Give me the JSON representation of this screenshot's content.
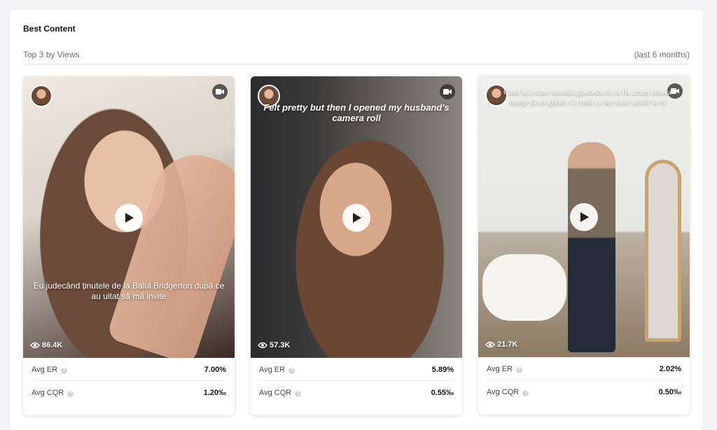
{
  "section": {
    "title": "Best Content",
    "subtitle": "Top 3 by Views",
    "period": "(last 6 months)"
  },
  "cards": [
    {
      "overlay_text": "Eu judecând ținutele de la Balul Bridgerton după ce au uitat să mă invite",
      "views": "86.4K",
      "avg_er_label": "Avg ER",
      "avg_er": "7.00%",
      "avg_cqr_label": "Avg CQR",
      "avg_cqr": "1.20‰"
    },
    {
      "overlay_text": "Felt pretty but then I opened my husband's camera roll",
      "views": "57.3K",
      "avg_er_label": "Avg ER",
      "avg_er": "5.89%",
      "avg_cqr_label": "Avg CQR",
      "avg_cqr": "0.55‰"
    },
    {
      "overlay_text": "Cand ai o stare nasoala gandeste-te ca fix acum cineva merge la un ghiseu si crede ca are toate actele la el",
      "views": "21.7K",
      "avg_er_label": "Avg ER",
      "avg_er": "2.02%",
      "avg_cqr_label": "Avg CQR",
      "avg_cqr": "0.50‰"
    }
  ],
  "icons": {
    "video": "video-camera-icon",
    "play": "play-icon",
    "views": "eye-icon",
    "help": "question-circle-icon"
  }
}
